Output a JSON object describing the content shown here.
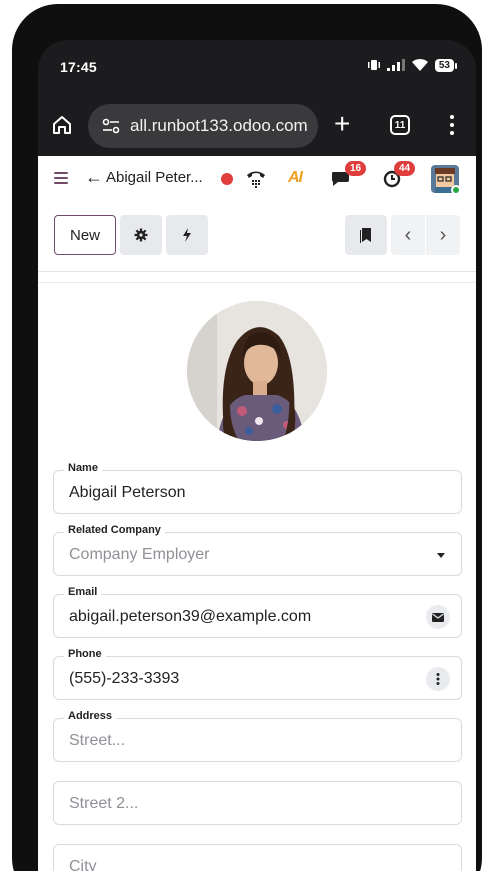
{
  "status_bar": {
    "time": "17:45",
    "battery": "53"
  },
  "browser": {
    "url": "all.runbot133.odoo.com",
    "tabs_count": "11"
  },
  "navbar": {
    "breadcrumb": "Abigail Peter...",
    "ai_label": "AI",
    "messages_count": "16",
    "activities_count": "44"
  },
  "control_panel": {
    "new_label": "New"
  },
  "form": {
    "name": {
      "label": "Name",
      "value": "Abigail Peterson"
    },
    "company": {
      "label": "Related Company",
      "placeholder": "Company Employer"
    },
    "email": {
      "label": "Email",
      "value": "abigail.peterson39@example.com"
    },
    "phone": {
      "label": "Phone",
      "value": "(555)-233-3393"
    },
    "address": {
      "label": "Address",
      "street_placeholder": "Street...",
      "street2_placeholder": "Street 2...",
      "city_placeholder": "City"
    }
  },
  "colors": {
    "brand": "#714b67",
    "badge": "#e03d3d",
    "record": "#e23d3d",
    "online": "#28a745"
  },
  "icons": [
    "home-icon",
    "site-settings-icon",
    "new-tab-icon",
    "tabs-icon",
    "browser-menu-icon",
    "hamburger-icon",
    "back-arrow-icon",
    "voip-phone-icon",
    "ai-icon",
    "chat-icon",
    "clock-icon",
    "gear-icon",
    "bolt-icon",
    "bookmark-icon",
    "chevron-left-icon",
    "chevron-right-icon",
    "envelope-icon",
    "kebab-icon",
    "caret-down-icon"
  ]
}
